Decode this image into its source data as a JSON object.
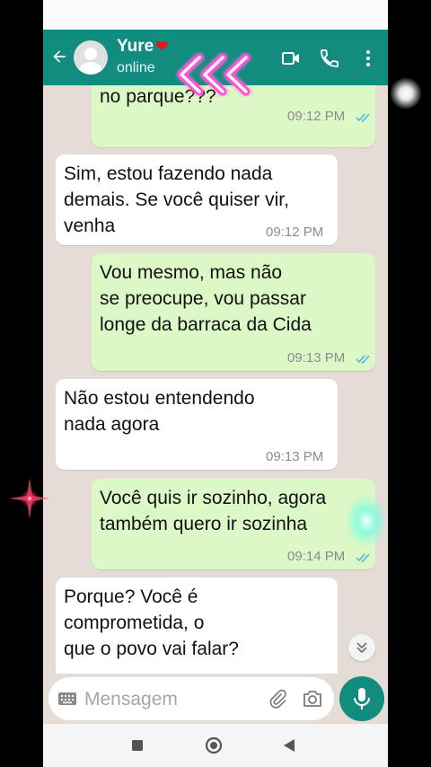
{
  "header": {
    "contact_name": "Yure",
    "heart_glyph": "❤",
    "status": "online",
    "icons": [
      "back-arrow-icon",
      "avatar",
      "video-call-icon",
      "phone-icon",
      "more-vert-icon"
    ]
  },
  "messages": [
    {
      "dir": "out",
      "text": "no parque???",
      "time": "09:12 PM",
      "read": true
    },
    {
      "dir": "in",
      "text": "Sim, estou fazendo nada\ndemais. Se você quiser vir,\nvenha",
      "time": "09:12 PM"
    },
    {
      "dir": "out",
      "text": "Vou mesmo, mas não\nse preocupe, vou passar\nlonge da barraca da Cida",
      "time": "09:13 PM",
      "read": true
    },
    {
      "dir": "in",
      "text": "Não estou entendendo\nnada agora",
      "time": "09:13 PM"
    },
    {
      "dir": "out",
      "text": "Você quis ir sozinho, agora\ntambém quero ir sozinha",
      "time": "09:14 PM",
      "read": true
    },
    {
      "dir": "in",
      "text": "Porque? Você é\ncomprometida, o\nque o povo vai falar?"
    }
  ],
  "composer": {
    "placeholder": "Mensagem"
  },
  "colors": {
    "header": "#128c7e",
    "outgoing": "#dcf8c6",
    "incoming": "#ffffff",
    "chat_bg": "#e5ddd5",
    "read_ticks": "#4fb6ec"
  }
}
